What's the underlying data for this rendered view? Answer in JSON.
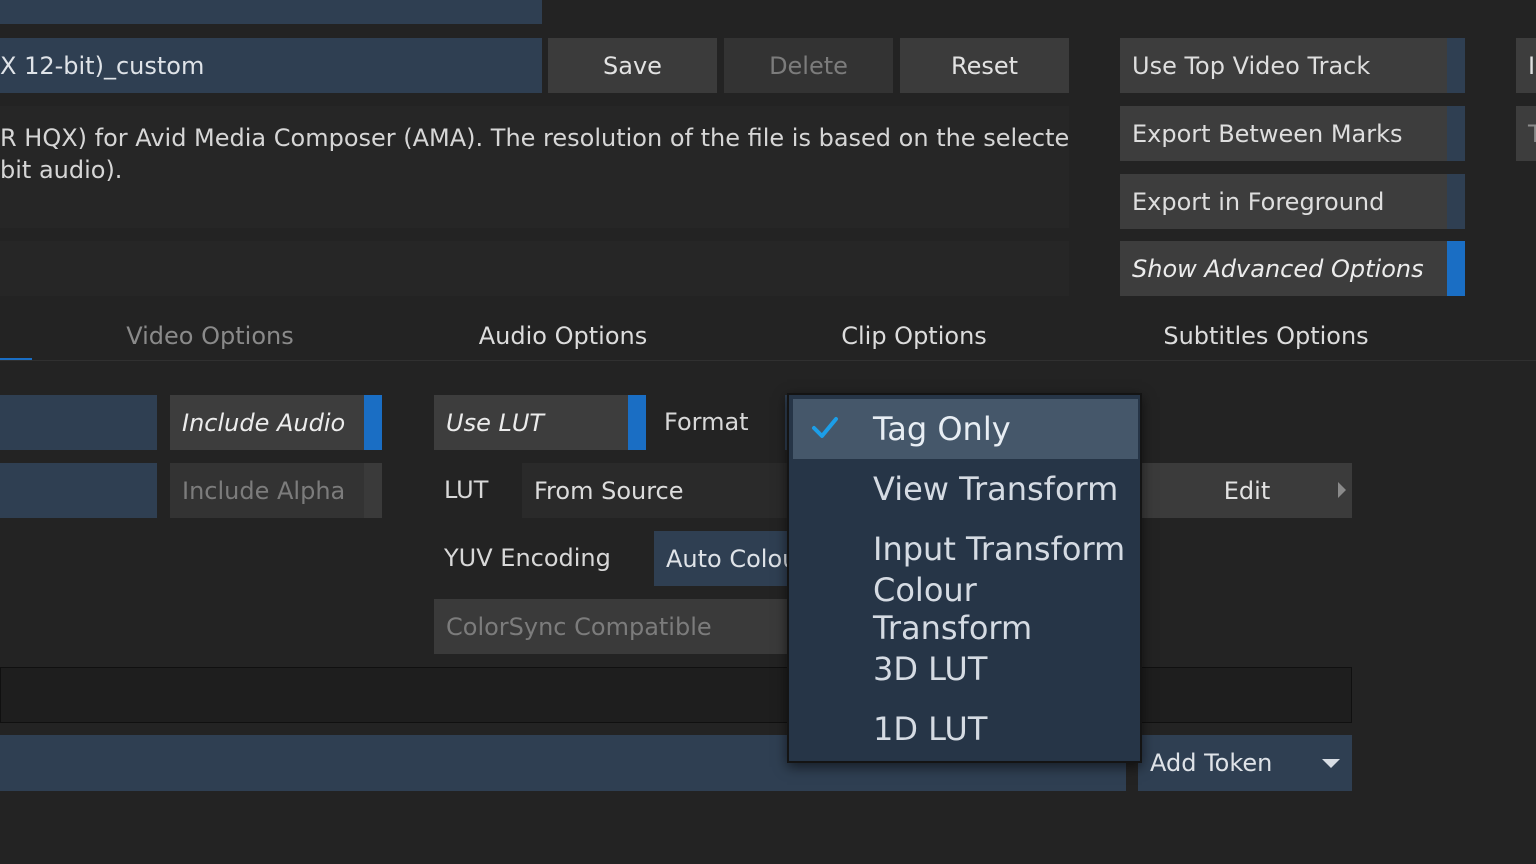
{
  "preset": {
    "name_value": "X 12-bit)_custom",
    "save_label": "Save",
    "delete_label": "Delete",
    "reset_label": "Reset",
    "description_line1": "R HQX) for Avid Media Composer (AMA).  The resolution of the file is based on the selected",
    "description_line2": "bit audio)."
  },
  "right_options": {
    "use_top_video_track": "Use Top Video Track",
    "export_between_marks": "Export Between Marks",
    "export_in_foreground": "Export in Foreground",
    "show_advanced_options": "Show Advanced Options",
    "edge_top": "I",
    "edge_bottom": "T"
  },
  "tabs": {
    "video": "Video Options",
    "audio": "Audio Options",
    "clip": "Clip Options",
    "subtitles": "Subtitles Options"
  },
  "options": {
    "include_audio": "Include Audio",
    "include_alpha": "Include Alpha",
    "use_lut": "Use LUT",
    "format_label": "Format",
    "lut_label": "LUT",
    "lut_value": "From Source",
    "edit_label": "Edit",
    "yuv_label": "YUV Encoding",
    "yuv_value": "Auto Colou",
    "colorsync": "ColorSync Compatible",
    "add_token": "Add Token"
  },
  "format_dropdown": {
    "items": [
      "Tag Only",
      "View Transform",
      "Input Transform",
      "Colour Transform",
      "3D LUT",
      "1D LUT"
    ],
    "selected": "Tag Only"
  },
  "colors": {
    "accent": "#1a6ec4",
    "field": "#2f3f52",
    "check": "#1c9ee8"
  }
}
